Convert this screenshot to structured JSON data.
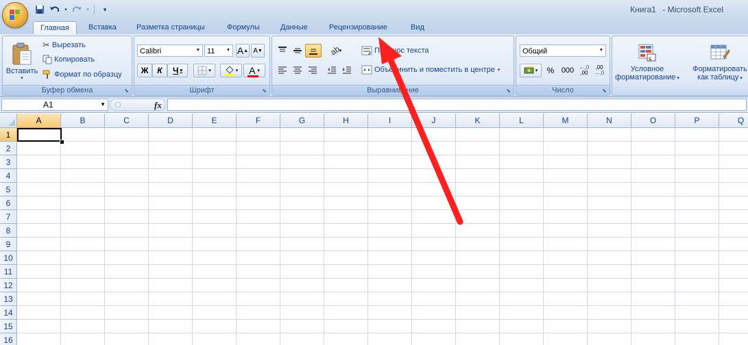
{
  "window": {
    "doc_name": "Книга1",
    "separator": "-",
    "app_name": "Microsoft Excel"
  },
  "qat": {
    "save_icon": "save-icon",
    "undo_icon": "undo-icon",
    "redo_icon": "redo-icon",
    "customize_icon": "customize-qat-icon"
  },
  "tabs": [
    {
      "label": "Главная",
      "active": true
    },
    {
      "label": "Вставка"
    },
    {
      "label": "Разметка страницы"
    },
    {
      "label": "Формулы"
    },
    {
      "label": "Данные"
    },
    {
      "label": "Рецензирование"
    },
    {
      "label": "Вид"
    }
  ],
  "ribbon": {
    "clipboard": {
      "label": "Буфер обмена",
      "paste": "Вставить",
      "cut": "Вырезать",
      "copy": "Копировать",
      "format_painter": "Формат по образцу"
    },
    "font": {
      "label": "Шрифт",
      "font_name": "Calibri",
      "font_size": "11",
      "bold": "Ж",
      "italic": "К",
      "underline": "Ч",
      "grow": "A",
      "shrink": "A",
      "font_color_letter": "A"
    },
    "alignment": {
      "label": "Выравнивание",
      "wrap_text": "Перенос текста",
      "merge_center": "Объединить и поместить в центре"
    },
    "number": {
      "label": "Число",
      "format": "Общий",
      "percent": "%",
      "thousands": "000",
      "inc_decimal": ",00",
      "dec_decimal": ",00"
    },
    "styles": {
      "conditional_line1": "Условное",
      "conditional_line2": "форматирование",
      "table_line1": "Форматировать",
      "table_line2": "как таблицу"
    }
  },
  "formula_bar": {
    "name_box": "A1",
    "fx": "fx",
    "formula": ""
  },
  "sheet": {
    "columns": [
      "A",
      "B",
      "C",
      "D",
      "E",
      "F",
      "G",
      "H",
      "I",
      "J",
      "K",
      "L",
      "M",
      "N",
      "O",
      "P",
      "Q"
    ],
    "rows": [
      "1",
      "2",
      "3",
      "4",
      "5",
      "6",
      "7",
      "8",
      "9",
      "10",
      "11",
      "12",
      "13",
      "14",
      "15",
      "16"
    ],
    "active_cell": "A1"
  },
  "annotation": {
    "color": "#ff2020",
    "icon": "red-arrow-annotation"
  }
}
